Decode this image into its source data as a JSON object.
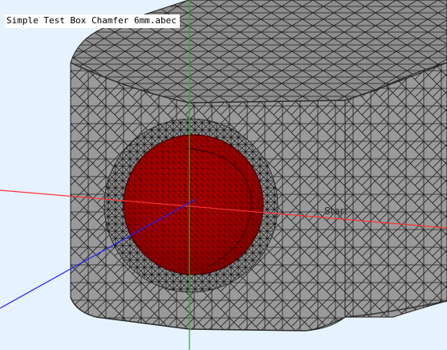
{
  "window": {
    "file_title": "Simple Test Box Chamfer 6mm.abec"
  },
  "scene": {
    "start_marker_label": "Start",
    "colors": {
      "background": "#e6f2ff",
      "box_face": "#999999",
      "box_top": "#8c8c8c",
      "mesh_line": "#1a1a1a",
      "driver": "#b30000",
      "axis_x": "#ff0000",
      "axis_y": "#00c800",
      "axis_z": "#0000ff"
    }
  }
}
